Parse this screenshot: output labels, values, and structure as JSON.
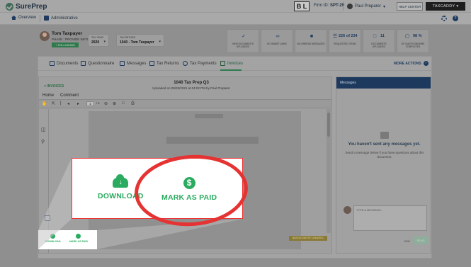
{
  "header": {
    "logo_text": "SurePrep",
    "bl_badge": "B L",
    "firm_label": "Firm ID:",
    "firm_id": "SPT-29",
    "user_name": "Paul Preparer",
    "help_center": "HELP CENTER",
    "taxcaddy": "TAXCADDY"
  },
  "breadcrumb": {
    "overview": "Overview",
    "administrative": "Administrative"
  },
  "client": {
    "name": "Tom Taxpayer",
    "phase": "PHASE : PROVIDE INFO",
    "follow_label": "+ FOLLOWING",
    "tax_year_label": "TAX YEAR",
    "tax_year": "2020",
    "tax_return_label": "TAX RETURN",
    "tax_return": "1040 - Tom Taxpayer"
  },
  "stats": [
    {
      "icon": "check-icon",
      "number": "",
      "label": "NEW DOCUMENTS UPLOADED"
    },
    {
      "icon": "link-icon",
      "number": "",
      "label": "NO SMART LINKS"
    },
    {
      "icon": "message-icon",
      "number": "",
      "label": "NO UNREAD MESSAGES"
    },
    {
      "icon": "list-icon",
      "number": "226 of 234",
      "label": "REQUESTED ITEMS"
    },
    {
      "icon": "document-icon",
      "number": "11",
      "label": "DOCUMENTS UPLOADED"
    },
    {
      "icon": "questionnaire-icon",
      "number": "98 %",
      "label": "OF QUESTIONNAIRE COMPLETED"
    }
  ],
  "tabs": [
    {
      "label": "Documents",
      "icon": "documents-icon",
      "active": false
    },
    {
      "label": "Questionnaire",
      "icon": "questionnaire-icon",
      "active": false
    },
    {
      "label": "Messages",
      "icon": "messages-icon",
      "active": false
    },
    {
      "label": "Tax Returns",
      "icon": "tax-returns-icon",
      "active": false
    },
    {
      "label": "Tax Payments",
      "icon": "dollar-icon",
      "active": false
    },
    {
      "label": "Invoices",
      "icon": "invoice-icon",
      "active": true
    }
  ],
  "more_actions": "MORE ACTIONS",
  "document": {
    "back_label": "< INVOICES",
    "title": "1040 Tax Prep Q3",
    "subtitle": "Uploaded on 09/28/2021 at 04:02 PM by Paul Preparer",
    "view_tabs": [
      "Home",
      "Comment"
    ],
    "page_current": "1",
    "page_total": "/ 1",
    "paid_strip": "$100.00 DUE BY 10/15/2021"
  },
  "messages": {
    "header": "Messages",
    "empty_title": "You haven't sent any messages yet.",
    "empty_hint": "Send a message below if you have questions about this document.",
    "input_placeholder": "TYPE A MESSAGE...",
    "char_count": "1000",
    "send_label": "SEND"
  },
  "actions": {
    "download": "DOWNLOAD",
    "mark_as_paid": "MARK AS PAID"
  },
  "colors": {
    "accent_green": "#2aab5f",
    "annotation_red": "#e53333",
    "navy": "#1d3a5e"
  }
}
